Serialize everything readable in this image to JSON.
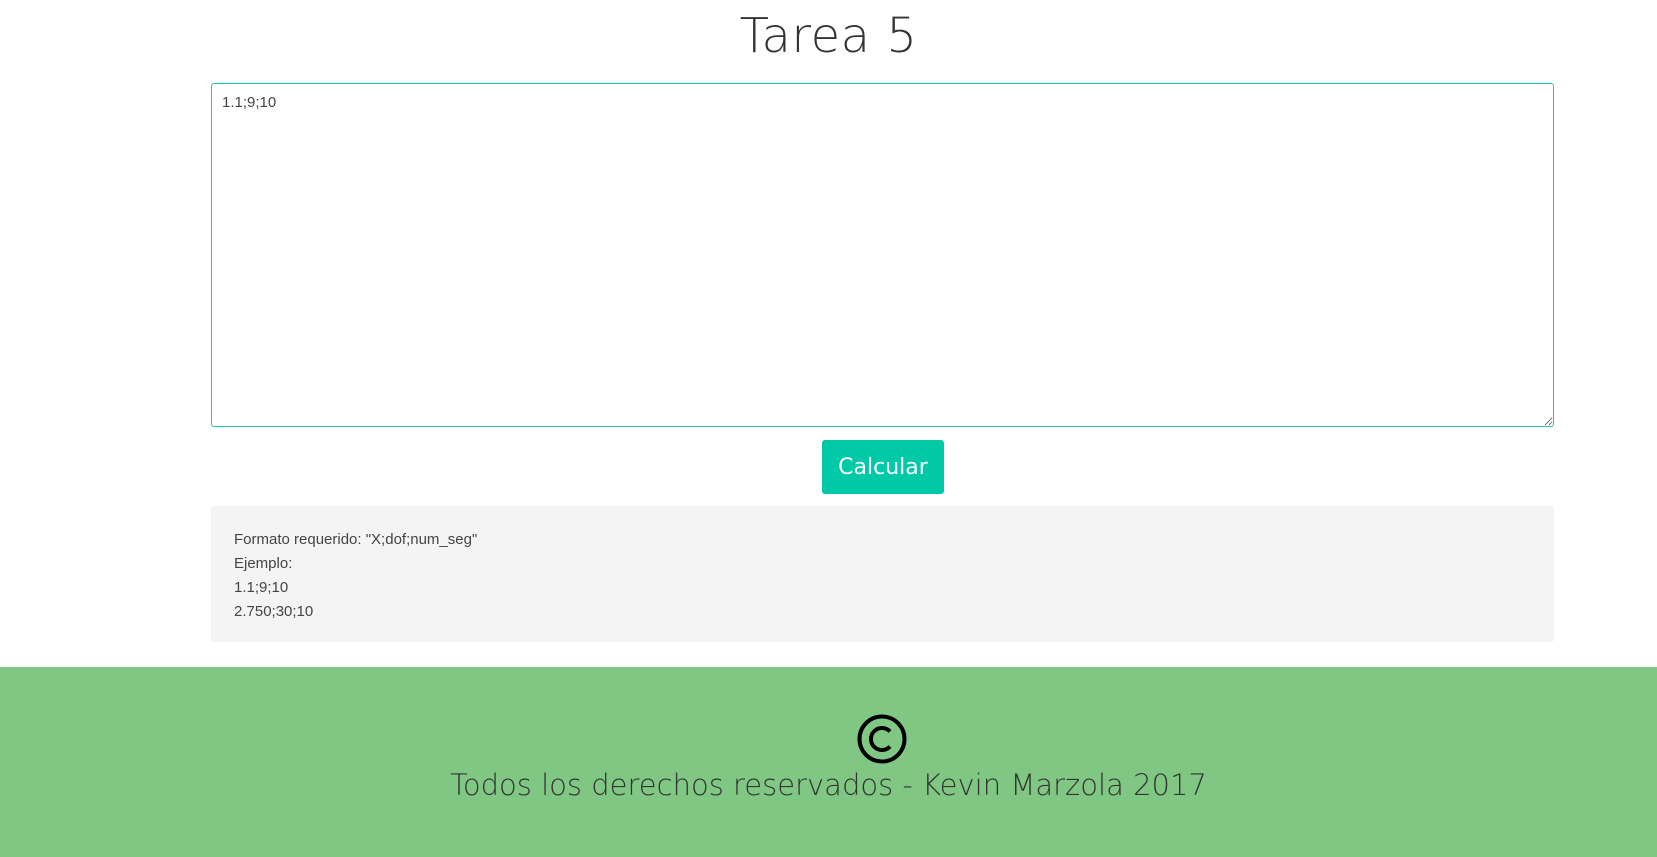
{
  "header": {
    "title": "Tarea 5"
  },
  "form": {
    "input_value": "1.1;9;10",
    "submit_label": "Calcular"
  },
  "info": {
    "lines": [
      "Formato requerido: \"X;dof;num_seg\"",
      "Ejemplo:",
      "1.1;9;10",
      "2.750;30;10"
    ]
  },
  "footer": {
    "icon": "copyright-icon",
    "text": "Todos los derechos reservados - Kevin Marzola 2017"
  },
  "colors": {
    "accent": "#00c9a7",
    "input_border": "#1ccaa8",
    "footer_bg": "#80c783",
    "info_bg": "#f4f4f4"
  }
}
